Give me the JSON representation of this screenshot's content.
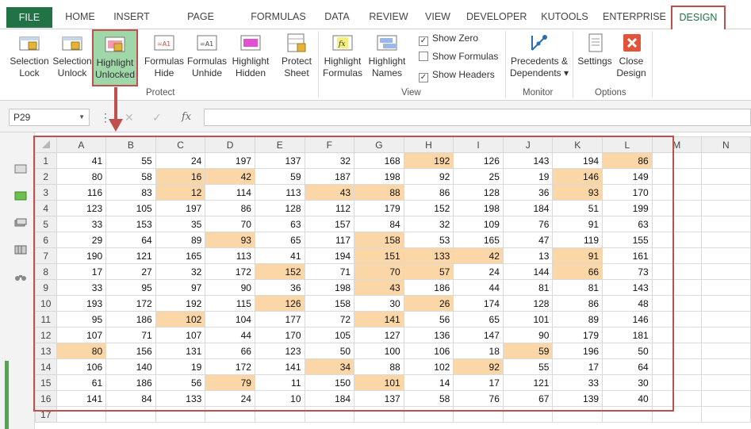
{
  "tabs": [
    "FILE",
    "HOME",
    "INSERT",
    "PAGE LAYOUT",
    "FORMULAS",
    "DATA",
    "REVIEW",
    "VIEW",
    "DEVELOPER",
    "KUTOOLS",
    "ENTERPRISE",
    "DESIGN"
  ],
  "ribbon": {
    "selection_lock": [
      "Selection",
      "Lock"
    ],
    "selection_unlock": [
      "Selection",
      "Unlock"
    ],
    "highlight_unlocked": [
      "Highlight",
      "Unlocked"
    ],
    "formulas_hide": [
      "Formulas",
      "Hide"
    ],
    "formulas_unhide": [
      "Formulas",
      "Unhide"
    ],
    "highlight_hidden": [
      "Highlight",
      "Hidden"
    ],
    "protect_sheet": [
      "Protect",
      "Sheet"
    ],
    "highlight_formulas": [
      "Highlight",
      "Formulas"
    ],
    "highlight_names": [
      "Highlight",
      "Names"
    ],
    "show_zero": "Show Zero",
    "show_formulas": "Show Formulas",
    "show_headers": "Show Headers",
    "show_zero_checked": true,
    "show_formulas_checked": false,
    "show_headers_checked": true,
    "precedents": [
      "Precedents &",
      "Dependents ▾"
    ],
    "settings": "Settings",
    "close_design": [
      "Close",
      "Design"
    ],
    "group_protect": "Protect",
    "group_view": "View",
    "group_monitor": "Monitor",
    "group_options": "Options"
  },
  "formula_bar": {
    "name_box": "P29",
    "fx": "fx"
  },
  "grid": {
    "columns": [
      "A",
      "B",
      "C",
      "D",
      "E",
      "F",
      "G",
      "H",
      "I",
      "J",
      "K",
      "L",
      "M",
      "N"
    ],
    "rows": [
      [
        41,
        55,
        24,
        197,
        137,
        32,
        168,
        192,
        126,
        143,
        194,
        86
      ],
      [
        80,
        58,
        16,
        42,
        59,
        187,
        198,
        92,
        25,
        19,
        146,
        149
      ],
      [
        116,
        83,
        12,
        114,
        113,
        43,
        88,
        86,
        128,
        36,
        93,
        170
      ],
      [
        123,
        105,
        197,
        86,
        128,
        112,
        179,
        152,
        198,
        184,
        51,
        199
      ],
      [
        33,
        153,
        35,
        70,
        63,
        157,
        84,
        32,
        109,
        76,
        91,
        63
      ],
      [
        29,
        64,
        89,
        93,
        65,
        117,
        158,
        53,
        165,
        47,
        119,
        155
      ],
      [
        190,
        121,
        165,
        113,
        41,
        194,
        151,
        133,
        42,
        13,
        91,
        161
      ],
      [
        17,
        27,
        32,
        172,
        152,
        71,
        70,
        57,
        24,
        144,
        66,
        73
      ],
      [
        33,
        95,
        97,
        90,
        36,
        198,
        43,
        186,
        44,
        81,
        81,
        143
      ],
      [
        193,
        172,
        192,
        115,
        126,
        158,
        30,
        26,
        174,
        128,
        86,
        48
      ],
      [
        95,
        186,
        102,
        104,
        177,
        72,
        141,
        56,
        65,
        101,
        89,
        146
      ],
      [
        107,
        71,
        107,
        44,
        170,
        105,
        127,
        136,
        147,
        90,
        179,
        181
      ],
      [
        80,
        156,
        131,
        66,
        123,
        50,
        100,
        106,
        18,
        59,
        196,
        50
      ],
      [
        106,
        140,
        19,
        172,
        141,
        34,
        88,
        102,
        92,
        55,
        17,
        64
      ],
      [
        61,
        186,
        56,
        79,
        11,
        150,
        101,
        14,
        17,
        121,
        33,
        30
      ],
      [
        141,
        84,
        133,
        24,
        10,
        184,
        137,
        58,
        76,
        67,
        139,
        40
      ]
    ],
    "highlighted": [
      [
        0,
        7
      ],
      [
        0,
        11
      ],
      [
        1,
        2
      ],
      [
        1,
        3
      ],
      [
        1,
        10
      ],
      [
        2,
        2
      ],
      [
        2,
        5
      ],
      [
        2,
        6
      ],
      [
        2,
        10
      ],
      [
        5,
        3
      ],
      [
        5,
        6
      ],
      [
        6,
        6
      ],
      [
        6,
        7
      ],
      [
        6,
        8
      ],
      [
        6,
        10
      ],
      [
        7,
        4
      ],
      [
        7,
        6
      ],
      [
        7,
        7
      ],
      [
        7,
        10
      ],
      [
        8,
        6
      ],
      [
        9,
        4
      ],
      [
        9,
        7
      ],
      [
        10,
        2
      ],
      [
        10,
        6
      ],
      [
        12,
        0
      ],
      [
        12,
        9
      ],
      [
        13,
        5
      ],
      [
        13,
        8
      ],
      [
        14,
        3
      ],
      [
        14,
        6
      ]
    ],
    "extra_row_label": "17",
    "highlight_color": "#fbd7a7"
  },
  "colors": {
    "accent": "#217346",
    "frame": "#c0504d",
    "highlight_button": "#9fd7a8"
  }
}
